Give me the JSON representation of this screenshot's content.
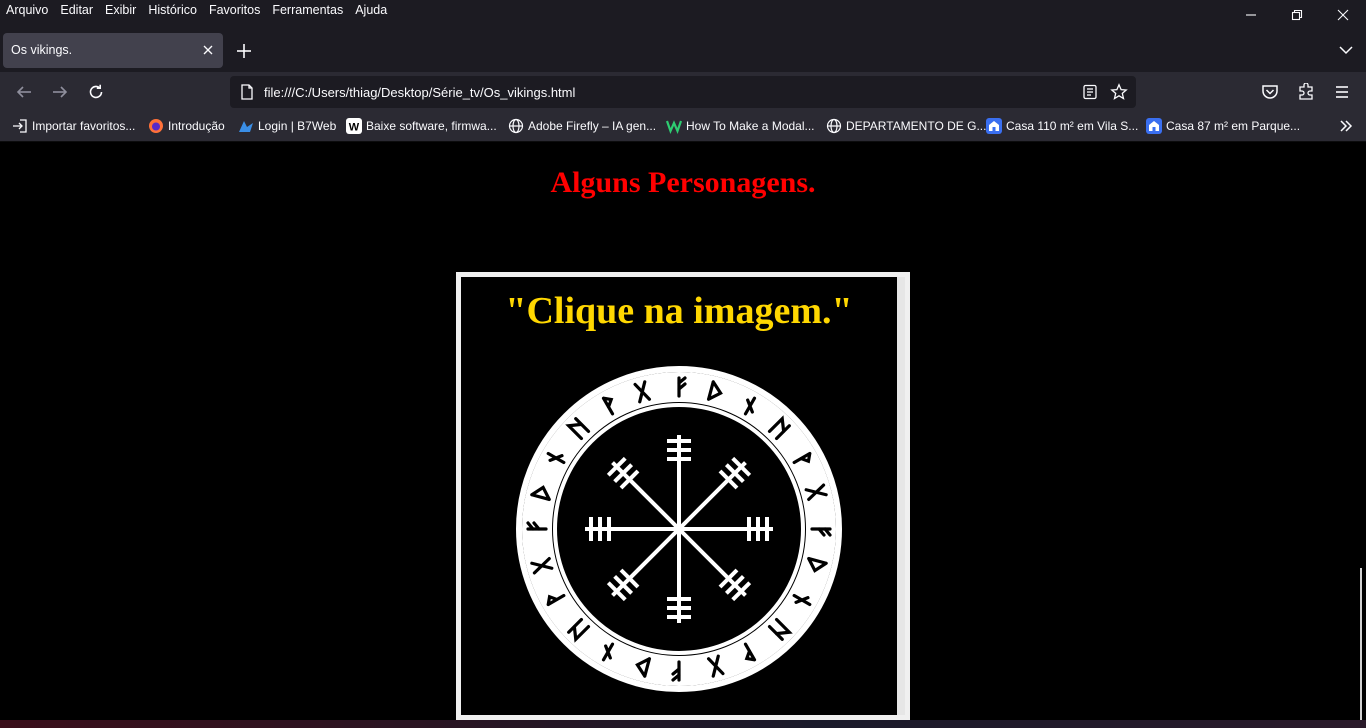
{
  "menu": {
    "items": [
      "Arquivo",
      "Editar",
      "Exibir",
      "Histórico",
      "Favoritos",
      "Ferramentas",
      "Ajuda"
    ]
  },
  "tab": {
    "title": "Os vikings."
  },
  "url": "file:///C:/Users/thiag/Desktop/Série_tv/Os_vikings.html",
  "bookmarks": [
    {
      "label": "Importar favoritos...",
      "icon": "import-icon",
      "color": "#fbfbfe"
    },
    {
      "label": "Introdução",
      "icon": "firefox-icon",
      "color": "#ff7139"
    },
    {
      "label": "Login | B7Web",
      "icon": "b7web-icon",
      "color": "#3a8ee6"
    },
    {
      "label": "Baixe software, firmwa...",
      "icon": "w-icon",
      "color": "#ffffff"
    },
    {
      "label": "Adobe Firefly – IA gen...",
      "icon": "globe-icon",
      "color": "#fbfbfe"
    },
    {
      "label": "How To Make a Modal...",
      "icon": "w-green-icon",
      "color": "#2ecc71"
    },
    {
      "label": "DEPARTAMENTO DE G...",
      "icon": "globe-icon",
      "color": "#fbfbfe"
    },
    {
      "label": "Casa 110 m² em Vila S...",
      "icon": "house-icon",
      "color": "#3a6ff0"
    },
    {
      "label": "Casa 87 m² em Parque...",
      "icon": "house-icon",
      "color": "#3a6ff0"
    }
  ],
  "page": {
    "heading": "Alguns Personagens.",
    "frame_title": "\"Clique na imagem.\""
  },
  "colors": {
    "heading": "#ff0000",
    "frame_title": "#ffd700",
    "background": "#000000"
  }
}
